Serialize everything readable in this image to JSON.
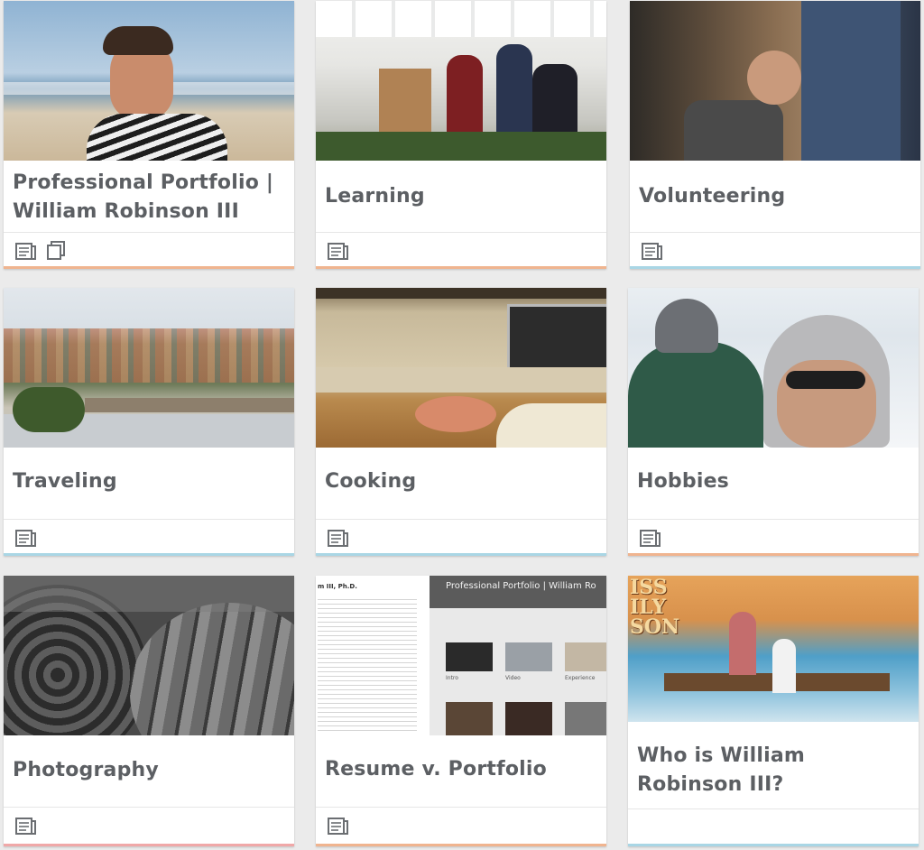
{
  "cards": [
    {
      "title": "Professional Portfolio | William Robinson III",
      "accent": "#f0b48f",
      "icons": [
        "document-icon",
        "copy-icon"
      ]
    },
    {
      "title": "Learning",
      "accent": "#f0b48f",
      "icons": [
        "document-icon"
      ]
    },
    {
      "title": "Volunteering",
      "accent": "#a9d6e5",
      "icons": [
        "document-icon"
      ]
    },
    {
      "title": "Traveling",
      "accent": "#a9d6e5",
      "icons": [
        "document-icon"
      ]
    },
    {
      "title": "Cooking",
      "accent": "#a9d6e5",
      "icons": [
        "document-icon"
      ]
    },
    {
      "title": "Hobbies",
      "accent": "#f0b48f",
      "icons": [
        "document-icon"
      ]
    },
    {
      "title": "Photography",
      "accent": "#f0a8a8",
      "icons": [
        "document-icon"
      ]
    },
    {
      "title": "Resume v. Portfolio",
      "accent": "#f0b48f",
      "icons": [
        "document-icon"
      ]
    },
    {
      "title": "Who is William Robinson III?",
      "accent": "#a9d6e5",
      "icons": []
    }
  ],
  "resume_thumb": {
    "name_fragment": "m III, Ph.D.",
    "portfolio_header": "Professional Portfolio | William Ro",
    "tiles": [
      "Intro",
      "Video",
      "Experience"
    ]
  },
  "movie_thumb": {
    "title_fragment": "ISS ILY SON"
  }
}
